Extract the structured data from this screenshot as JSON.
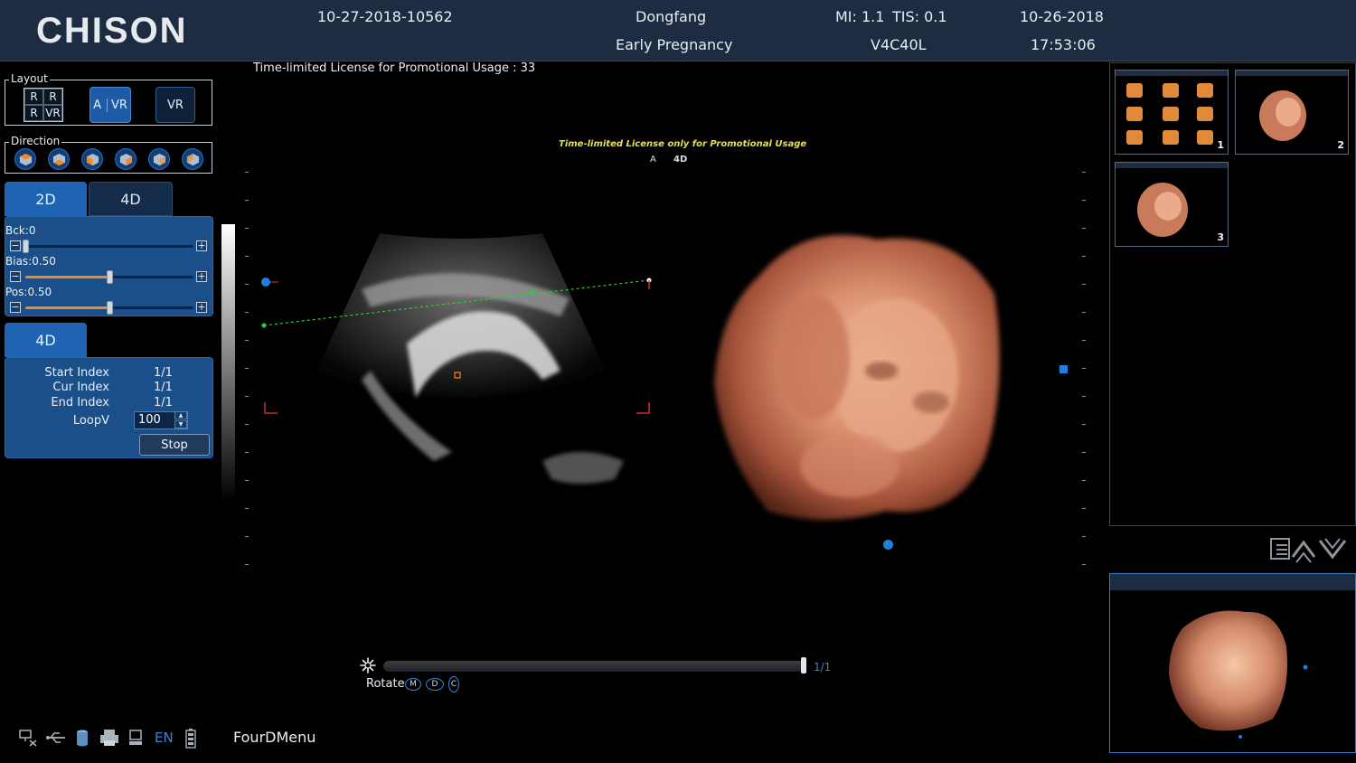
{
  "header": {
    "logo": "CHISON",
    "patient_id": "10-27-2018-10562",
    "hospital": "Dongfang",
    "exam_type": "Early Pregnancy",
    "mi": "MI:  1.1",
    "tis": "TIS:  0.1",
    "probe": "V4C40L",
    "date": "10-26-2018",
    "time": "17:53:06"
  },
  "layout": {
    "title": "Layout",
    "grid_cells": [
      "R",
      "R",
      "R",
      "VR"
    ],
    "btn_a_label": "A",
    "btn_a_vr_label": "VR",
    "btn_vr_label": "VR"
  },
  "direction": {
    "title": "Direction",
    "count": 6
  },
  "tabs": {
    "tab_2d": "2D",
    "tab_4d": "4D",
    "tab_4d_lower": "4D"
  },
  "sliders": [
    {
      "label": "Bck:0",
      "value": 0.0
    },
    {
      "label": "Bias:0.50",
      "value": 0.5
    },
    {
      "label": "Pos:0.50",
      "value": 0.5
    }
  ],
  "cine_info": {
    "start_index_label": "Start Index",
    "start_index_value": "1/1",
    "cur_index_label": "Cur Index",
    "cur_index_value": "1/1",
    "end_index_label": "End Index",
    "end_index_value": "1/1",
    "loopv_label": "LoopV",
    "loopv_value": "100",
    "stop_label": "Stop"
  },
  "image": {
    "license_text": "Time-limited License for Promotional Usage : 33",
    "watermark": "Time-limited License only for Promotional Usage",
    "label_a": "A",
    "label_4d": "4D",
    "cine_counter": "1/1",
    "rotate_label": "Rotate",
    "rotate_m": "M",
    "rotate_d": "D",
    "rotate_c": "C"
  },
  "thumbnails": [
    {
      "number": "1"
    },
    {
      "number": "2"
    },
    {
      "number": "3"
    }
  ],
  "status": {
    "language": "EN",
    "menu": "FourDMenu"
  },
  "colors": {
    "accent_blue": "#1f63b3",
    "slider_orange": "#f08a24",
    "roi_red": "#d42a2a",
    "watermark_yellow": "#e6e04a",
    "cine_blue": "#3f82d8"
  }
}
